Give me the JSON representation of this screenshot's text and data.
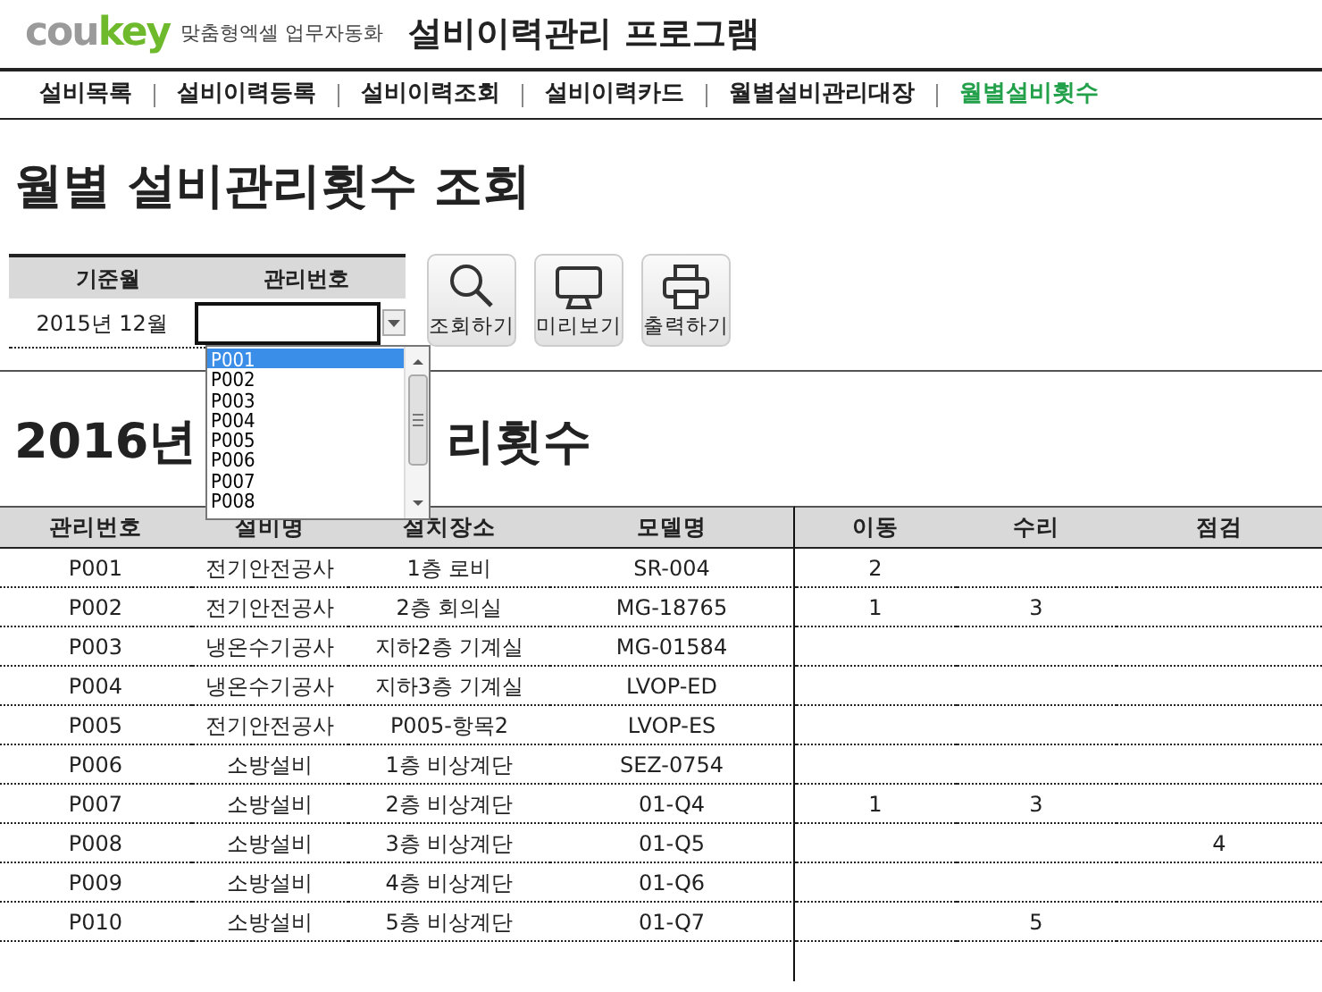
{
  "header": {
    "logo": [
      {
        "text": "cou",
        "color": "#9a9a9a"
      },
      {
        "text": "key",
        "color": "#6fba2c"
      }
    ],
    "tagline": "맞춤형엑셀 업무자동화",
    "title": "설비이력관리 프로그램"
  },
  "nav": [
    {
      "label": "설비목록",
      "selected": false
    },
    {
      "label": "설비이력등록",
      "selected": false
    },
    {
      "label": "설비이력조회",
      "selected": false
    },
    {
      "label": "설비이력카드",
      "selected": false
    },
    {
      "label": "월별설비관리대장",
      "selected": false
    },
    {
      "label": "월별설비횟수",
      "selected": true
    }
  ],
  "page_title": "월별 설비관리횟수 조회",
  "filter": {
    "columns": [
      "기준월",
      "관리번호"
    ],
    "month": "2015년 12월"
  },
  "dropdown": {
    "items": [
      {
        "label": "P001",
        "selected": true
      },
      {
        "label": "P002",
        "selected": false
      },
      {
        "label": "P003",
        "selected": false
      },
      {
        "label": "P004",
        "selected": false
      },
      {
        "label": "P005",
        "selected": false
      },
      {
        "label": "P006",
        "selected": false
      },
      {
        "label": "P007",
        "selected": false
      },
      {
        "label": "P008",
        "selected": false
      }
    ]
  },
  "toolbar": [
    {
      "label": "조회하기",
      "kind": "search"
    },
    {
      "label": "미리보기",
      "kind": "preview"
    },
    {
      "label": "출력하기",
      "kind": "print"
    }
  ],
  "report_title": {
    "visible_parts": [
      "2016년",
      "리횟수"
    ]
  },
  "table": {
    "columns": [
      "관리번호",
      "설비명",
      "설치장소",
      "모델명",
      "이동",
      "수리",
      "점검"
    ],
    "rows": [
      [
        "P001",
        "전기안전공사",
        "1층 로비",
        "SR-004",
        "2",
        null,
        null
      ],
      [
        "P002",
        "전기안전공사",
        "2층 회의실",
        "MG-18765",
        "1",
        "3",
        null
      ],
      [
        "P003",
        "냉온수기공사",
        "지하2층 기계실",
        "MG-01584",
        null,
        null,
        null
      ],
      [
        "P004",
        "냉온수기공사",
        "지하3층 기계실",
        "LVOP-ED",
        null,
        null,
        null
      ],
      [
        "P005",
        "전기안전공사",
        "P005-항목2",
        "LVOP-ES",
        null,
        null,
        null
      ],
      [
        "P006",
        "소방설비",
        "1층 비상계단",
        "SEZ-0754",
        null,
        null,
        null
      ],
      [
        "P007",
        "소방설비",
        "2층 비상계단",
        "01-Q4",
        "1",
        "3",
        null
      ],
      [
        "P008",
        "소방설비",
        "3층 비상계단",
        "01-Q5",
        null,
        null,
        "4"
      ],
      [
        "P009",
        "소방설비",
        "4층 비상계단",
        "01-Q6",
        null,
        null,
        null
      ],
      [
        "P010",
        "소방설비",
        "5층 비상계단",
        "01-Q7",
        null,
        "5",
        null
      ]
    ]
  }
}
